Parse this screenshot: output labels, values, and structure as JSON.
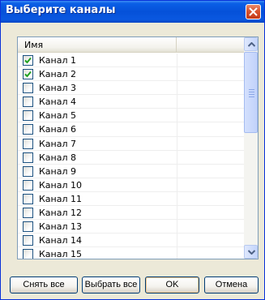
{
  "window": {
    "title": "Выберите каналы"
  },
  "list": {
    "column_header": "Имя",
    "rows": [
      {
        "label": "Канал 1",
        "checked": true
      },
      {
        "label": "Канал 2",
        "checked": true
      },
      {
        "label": "Канал 3",
        "checked": false
      },
      {
        "label": "Канал 4",
        "checked": false
      },
      {
        "label": "Канал 5",
        "checked": false
      },
      {
        "label": "Канал 6",
        "checked": false
      },
      {
        "label": "Канал 7",
        "checked": false
      },
      {
        "label": "Канал 8",
        "checked": false
      },
      {
        "label": "Канал 9",
        "checked": false
      },
      {
        "label": "Канал 10",
        "checked": false
      },
      {
        "label": "Канал 11",
        "checked": false
      },
      {
        "label": "Канал 12",
        "checked": false
      },
      {
        "label": "Канал 13",
        "checked": false
      },
      {
        "label": "Канал 14",
        "checked": false
      },
      {
        "label": "Канал 15",
        "checked": false
      }
    ]
  },
  "buttons": {
    "deselect_all": "Снять все",
    "select_all": "Выбрать все",
    "ok": "OK",
    "cancel": "Отмена"
  },
  "icons": {
    "close": "close-icon",
    "check": "checkmark-icon",
    "scroll_up": "arrow-up-icon",
    "scroll_down": "arrow-down-icon"
  },
  "colors": {
    "titlebar": "#0a5fe6",
    "close_button": "#d8542e",
    "checkmark": "#21a121",
    "dialog_background": "#ece9d8"
  }
}
